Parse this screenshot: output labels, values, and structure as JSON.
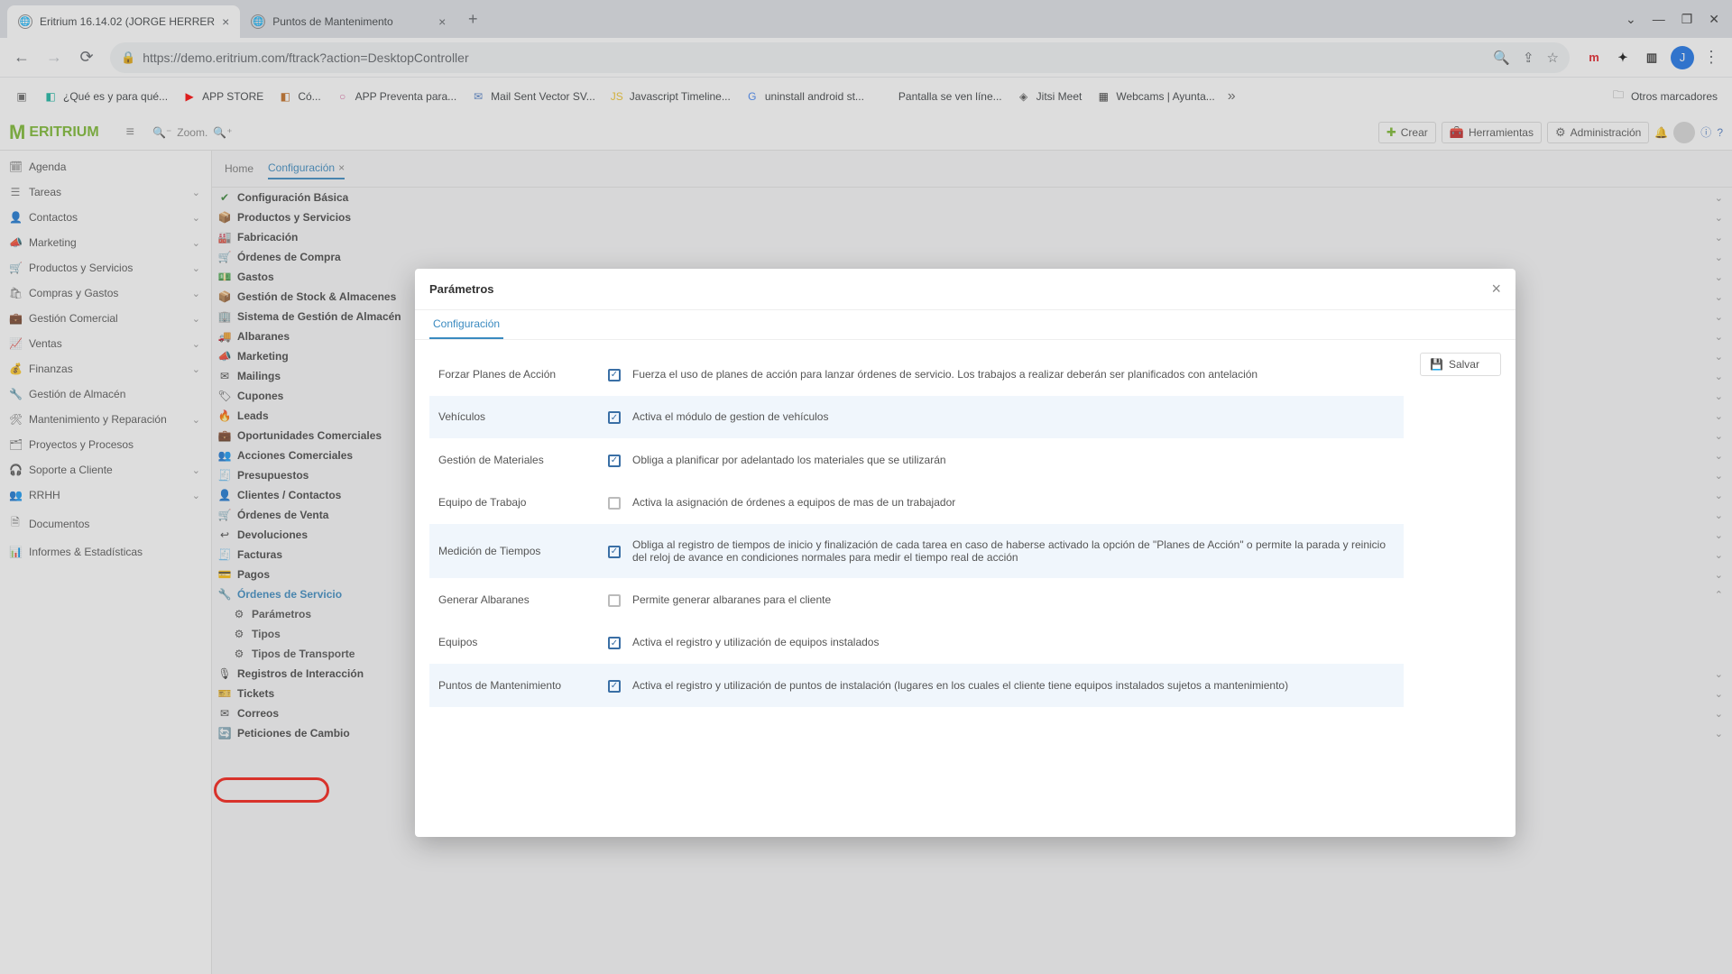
{
  "browser": {
    "tabs": [
      {
        "title": "Eritrium 16.14.02 (JORGE HERRER",
        "close": "×"
      },
      {
        "title": "Puntos de Mantenimento",
        "close": "×"
      }
    ],
    "new_tab": "+",
    "win": {
      "min": "⌄",
      "minimize": "—",
      "max": "❐",
      "close": "✕"
    },
    "url": "https://demo.eritrium.com/ftrack?action=DesktopController",
    "avatar_letter": "J",
    "bookmarks": [
      {
        "icon": "▣",
        "label": ""
      },
      {
        "icon": "◧",
        "label": "¿Qué es y para qué...",
        "color": "#16b5a1"
      },
      {
        "icon": "▶",
        "label": "APP STORE",
        "color": "#ff0000"
      },
      {
        "icon": "◧",
        "label": "Có...",
        "color": "#c26b1f"
      },
      {
        "icon": "○",
        "label": "APP Preventa para...",
        "color": "#d96ba3"
      },
      {
        "icon": "✉",
        "label": "Mail Sent Vector SV...",
        "color": "#4f7dc5"
      },
      {
        "icon": "JS",
        "label": "Javascript Timeline...",
        "color": "#f0c52b"
      },
      {
        "icon": "G",
        "label": "uninstall android st...",
        "color": "#4285f4"
      },
      {
        "icon": "",
        "label": "Pantalla se ven líne...",
        "color": "#888"
      },
      {
        "icon": "◈",
        "label": "Jitsi Meet",
        "color": "#555"
      },
      {
        "icon": "▦",
        "label": "Webcams | Ayunta...",
        "color": "#333"
      }
    ],
    "more": "»",
    "other_folder_icon": "🗀",
    "other_folder": "Otros marcadores"
  },
  "app": {
    "logo_text": "ERITRIUM",
    "zoom": "Zoom.",
    "buttons": {
      "crear": "Crear",
      "herr": "Herramientas",
      "admin": "Administración"
    }
  },
  "sidebar": [
    {
      "icon": "🗓",
      "label": "Agenda",
      "chev": false
    },
    {
      "icon": "☰",
      "label": "Tareas",
      "chev": true
    },
    {
      "icon": "👤",
      "label": "Contactos",
      "chev": true
    },
    {
      "icon": "📣",
      "label": "Marketing",
      "chev": true
    },
    {
      "icon": "🛒",
      "label": "Productos y Servicios",
      "chev": true
    },
    {
      "icon": "🛍",
      "label": "Compras y Gastos",
      "chev": true
    },
    {
      "icon": "💼",
      "label": "Gestión Comercial",
      "chev": true
    },
    {
      "icon": "📈",
      "label": "Ventas",
      "chev": true
    },
    {
      "icon": "💰",
      "label": "Finanzas",
      "chev": true
    },
    {
      "icon": "🔧",
      "label": "Gestión de Almacén",
      "chev": false
    },
    {
      "icon": "🛠",
      "label": "Mantenimiento y Reparación",
      "chev": true
    },
    {
      "icon": "🗂",
      "label": "Proyectos y Procesos",
      "chev": false
    },
    {
      "icon": "🎧",
      "label": "Soporte a Cliente",
      "chev": true
    },
    {
      "icon": "👥",
      "label": "RRHH",
      "chev": true
    },
    {
      "icon": "🗎",
      "label": "Documentos",
      "chev": false
    },
    {
      "icon": "📊",
      "label": "Informes & Estadísticas",
      "chev": false
    }
  ],
  "crumbs": {
    "home": "Home",
    "config": "Configuración"
  },
  "tree": [
    {
      "icon": "✔",
      "label": "Configuración Básica",
      "cls": "greencheck",
      "chev": true
    },
    {
      "icon": "📦",
      "label": "Productos y Servicios",
      "chev": true
    },
    {
      "icon": "🏭",
      "label": "Fabricación",
      "chev": true
    },
    {
      "icon": "🛒",
      "label": "Órdenes de Compra",
      "chev": true
    },
    {
      "icon": "💵",
      "label": "Gastos",
      "chev": true
    },
    {
      "icon": "📦",
      "label": "Gestión de Stock & Almacenes",
      "chev": true
    },
    {
      "icon": "🏢",
      "label": "Sistema de Gestión de Almacén",
      "chev": true
    },
    {
      "icon": "🚚",
      "label": "Albaranes",
      "chev": true
    },
    {
      "icon": "📣",
      "label": "Marketing",
      "chev": true
    },
    {
      "icon": "✉",
      "label": "Mailings",
      "chev": true
    },
    {
      "icon": "🏷",
      "label": "Cupones",
      "chev": true
    },
    {
      "icon": "🔥",
      "label": "Leads",
      "chev": true
    },
    {
      "icon": "💼",
      "label": "Oportunidades Comerciales",
      "chev": true
    },
    {
      "icon": "👥",
      "label": "Acciones Comerciales",
      "chev": true
    },
    {
      "icon": "🧾",
      "label": "Presupuestos",
      "chev": true
    },
    {
      "icon": "👤",
      "label": "Clientes / Contactos",
      "chev": true
    },
    {
      "icon": "🛒",
      "label": "Órdenes de Venta",
      "chev": true
    },
    {
      "icon": "↩",
      "label": "Devoluciones",
      "chev": true
    },
    {
      "icon": "🧾",
      "label": "Facturas",
      "chev": true
    },
    {
      "icon": "💳",
      "label": "Pagos",
      "chev": true
    },
    {
      "icon": "🔧",
      "label": "Órdenes de Servicio",
      "chev": false,
      "color": "#3a8ac0"
    },
    {
      "icon": "⚙",
      "label": "Parámetros",
      "child": true,
      "hl": true
    },
    {
      "icon": "⚙",
      "label": "Tipos",
      "child": true
    },
    {
      "icon": "⚙",
      "label": "Tipos de Transporte",
      "child": true
    },
    {
      "icon": "🎙",
      "label": "Registros de Interacción",
      "chev": true
    },
    {
      "icon": "🎫",
      "label": "Tickets",
      "chev": true
    },
    {
      "icon": "✉",
      "label": "Correos",
      "chev": true
    },
    {
      "icon": "🔄",
      "label": "Peticiones de Cambio",
      "chev": true
    }
  ],
  "modal": {
    "title": "Parámetros",
    "tab": "Configuración",
    "save": "Salvar",
    "rows": [
      {
        "label": "Forzar Planes de Acción",
        "checked": true,
        "desc": "Fuerza el uso de planes de acción para lanzar órdenes de servicio. Los trabajos a realizar deberán ser planificados con antelación"
      },
      {
        "label": "Vehículos",
        "checked": true,
        "desc": "Activa el módulo de gestion de vehículos",
        "alt": true
      },
      {
        "label": "Gestión de Materiales",
        "checked": true,
        "desc": "Obliga a planificar por adelantado los materiales que se utilizarán"
      },
      {
        "label": "Equipo de Trabajo",
        "checked": false,
        "desc": "Activa la asignación de órdenes a equipos de mas de un trabajador"
      },
      {
        "label": "Medición de Tiempos",
        "checked": true,
        "desc": "Obliga al registro de tiempos de inicio y finalización de cada tarea en caso de haberse activado la opción de \"Planes de Acción\" o permite la parada y reinicio del reloj de avance en condiciones normales para medir el tiempo real de acción",
        "alt": true
      },
      {
        "label": "Generar Albaranes",
        "checked": false,
        "desc": "Permite generar albaranes para el cliente"
      },
      {
        "label": "Equipos",
        "checked": true,
        "desc": "Activa el registro y utilización de equipos instalados"
      },
      {
        "label": "Puntos de Mantenimiento",
        "checked": true,
        "desc": "Activa el registro y utilización de puntos de instalación (lugares en los cuales el cliente tiene equipos instalados sujetos a mantenimiento)",
        "alt": true
      }
    ]
  }
}
